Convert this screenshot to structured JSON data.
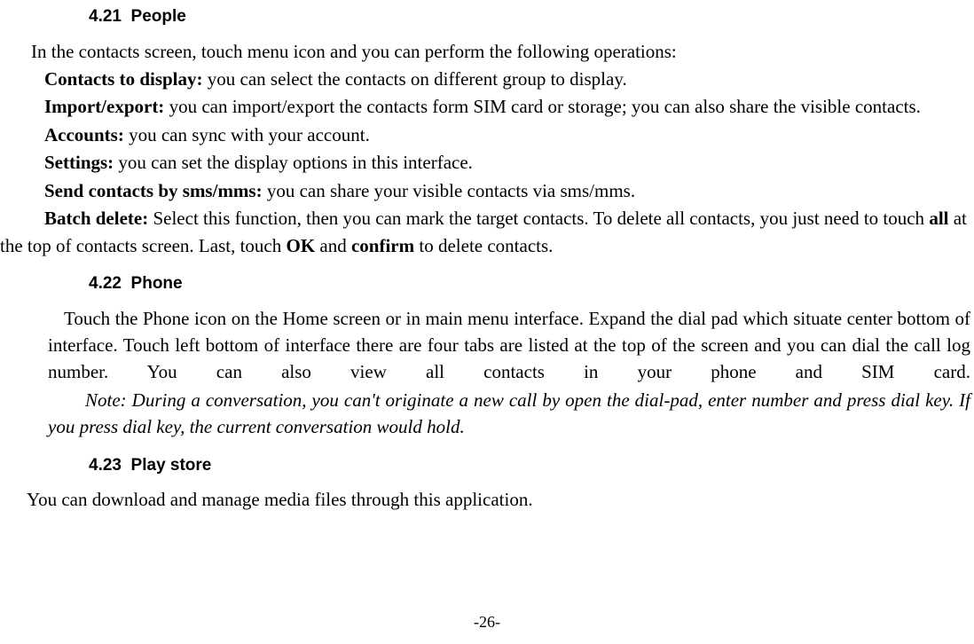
{
  "sec1": {
    "num": "4.21",
    "title": "People",
    "intro": "In the contacts screen, touch menu icon and you can perform the following operations:",
    "items": {
      "contacts_label": "Contacts to display:",
      "contacts_text": " you can select the contacts on different group to display.",
      "import_label": "Import/export:",
      "import_text": " you can import/export the contacts form SIM card or storage; you can also share the visible contacts.",
      "accounts_label": "Accounts:",
      "accounts_text": " you can sync with your account.",
      "settings_label": "Settings:",
      "settings_text": " you can set the display options in this interface.",
      "send_label": "Send contacts by sms/mms:",
      "send_text": " you can share your visible contacts via sms/mms.",
      "batch_label": "Batch delete:",
      "batch_text_pre": " Select this function, then you can mark the target contacts. To delete all contacts, you just need to touch ",
      "batch_all": "all",
      "batch_text_mid1": " at the top of contacts screen. Last, touch ",
      "batch_ok": "OK",
      "batch_text_mid2": " and ",
      "batch_confirm": "confirm",
      "batch_text_end": " to delete contacts."
    }
  },
  "sec2": {
    "num": "4.22",
    "title": "Phone",
    "para1": "Touch the Phone icon on the Home screen or in main menu interface. Expand the dial pad which situate center bottom of interface. Touch left bottom of interface there are four tabs are listed at the top of the screen and you can dial the call log number. You can also view all contacts in your phone and SIM card.",
    "note_pre": "Note: During a conversation, you can't originate a new call by open the dial-pad, enter number and press dial key. If you press dial key, the current conversation would hold."
  },
  "sec3": {
    "num": "4.23",
    "title": "Play store",
    "text": "You can download and manage media files through this application."
  },
  "page": "-26-"
}
